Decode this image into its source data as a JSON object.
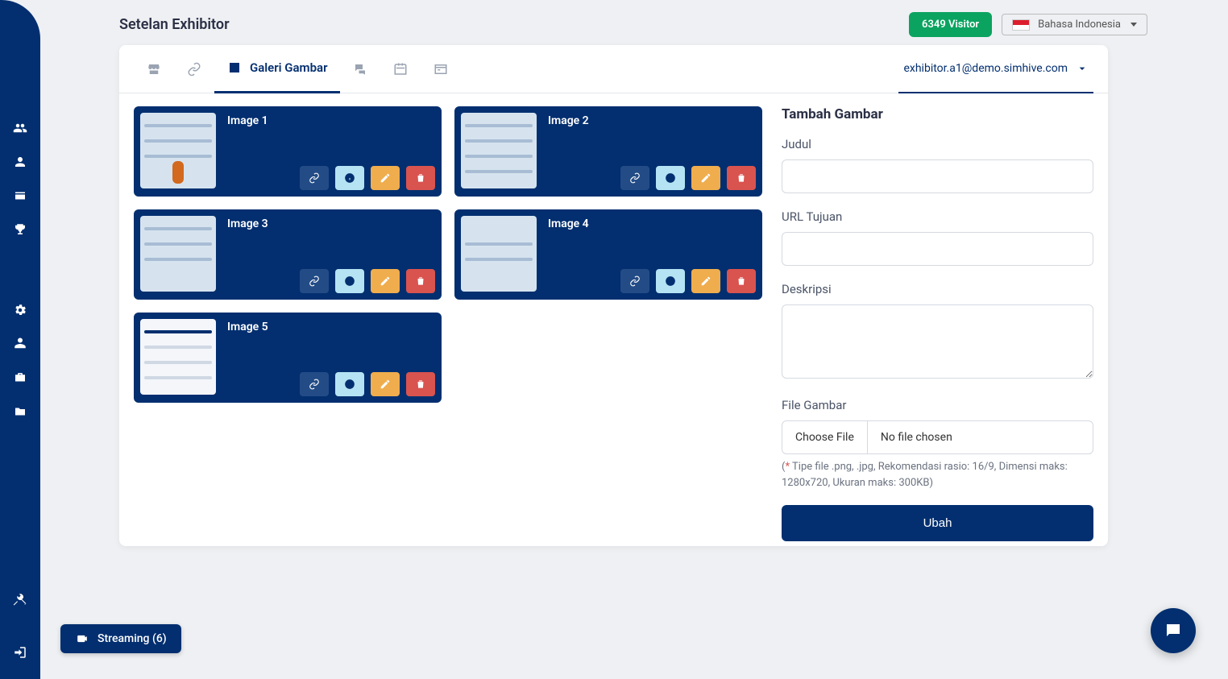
{
  "page_title": "Setelan Exhibitor",
  "visitor_badge": "6349 Visitor",
  "language": "Bahasa Indonesia",
  "user_email": "exhibitor.a1@demo.simhive.com",
  "tabs": {
    "active_label": "Galeri Gambar"
  },
  "gallery": [
    {
      "title": "Image 1"
    },
    {
      "title": "Image 2"
    },
    {
      "title": "Image 3"
    },
    {
      "title": "Image 4"
    },
    {
      "title": "Image 5"
    }
  ],
  "form": {
    "heading": "Tambah Gambar",
    "label_title": "Judul",
    "label_url": "URL Tujuan",
    "label_desc": "Deskripsi",
    "label_file": "File Gambar",
    "file_choose": "Choose File",
    "file_none": "No file chosen",
    "hint_prefix": "(",
    "hint_star": "*",
    "hint_body": " Tipe file .png, .jpg, Rekomendasi rasio: 16/9, Dimensi maks: 1280x720, Ukuran maks: 300KB)",
    "submit": "Ubah"
  },
  "streaming": "Streaming (6)"
}
